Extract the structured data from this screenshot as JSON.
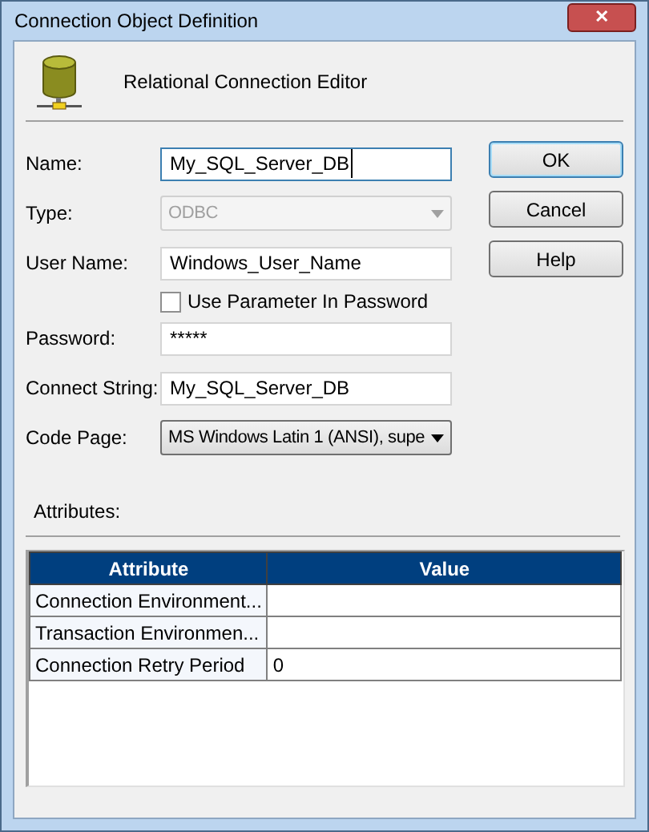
{
  "window": {
    "title": "Connection Object Definition",
    "close": "✕"
  },
  "header": "Relational Connection Editor",
  "fields": [
    {
      "kind": "text",
      "label": "Name:",
      "value": "My_SQL_Server_DB",
      "focused": true
    },
    {
      "kind": "select",
      "label": "Type:",
      "value": "ODBC",
      "disabled": true
    },
    {
      "kind": "text",
      "label": "User Name:",
      "value": "Windows_User_Name",
      "focused": false
    },
    {
      "kind": "checkbox",
      "label": "Use Parameter In Password",
      "checked": false
    },
    {
      "kind": "text",
      "label": "Password:",
      "value": "*****",
      "focused": false
    },
    {
      "kind": "text",
      "label": "Connect String:",
      "value": "My_SQL_Server_DB",
      "focused": false
    },
    {
      "kind": "select",
      "label": "Code Page:",
      "value": "MS Windows Latin 1 (ANSI), supe",
      "disabled": false
    }
  ],
  "buttons": [
    {
      "label": "OK",
      "default": true
    },
    {
      "label": "Cancel",
      "default": false
    },
    {
      "label": "Help",
      "default": false
    }
  ],
  "attributes": {
    "label": "Attributes:",
    "columns": [
      "Attribute",
      "Value"
    ],
    "rows": [
      [
        "Connection Environment...",
        ""
      ],
      [
        "Transaction Environmen...",
        ""
      ],
      [
        "Connection Retry Period",
        "0"
      ]
    ]
  }
}
